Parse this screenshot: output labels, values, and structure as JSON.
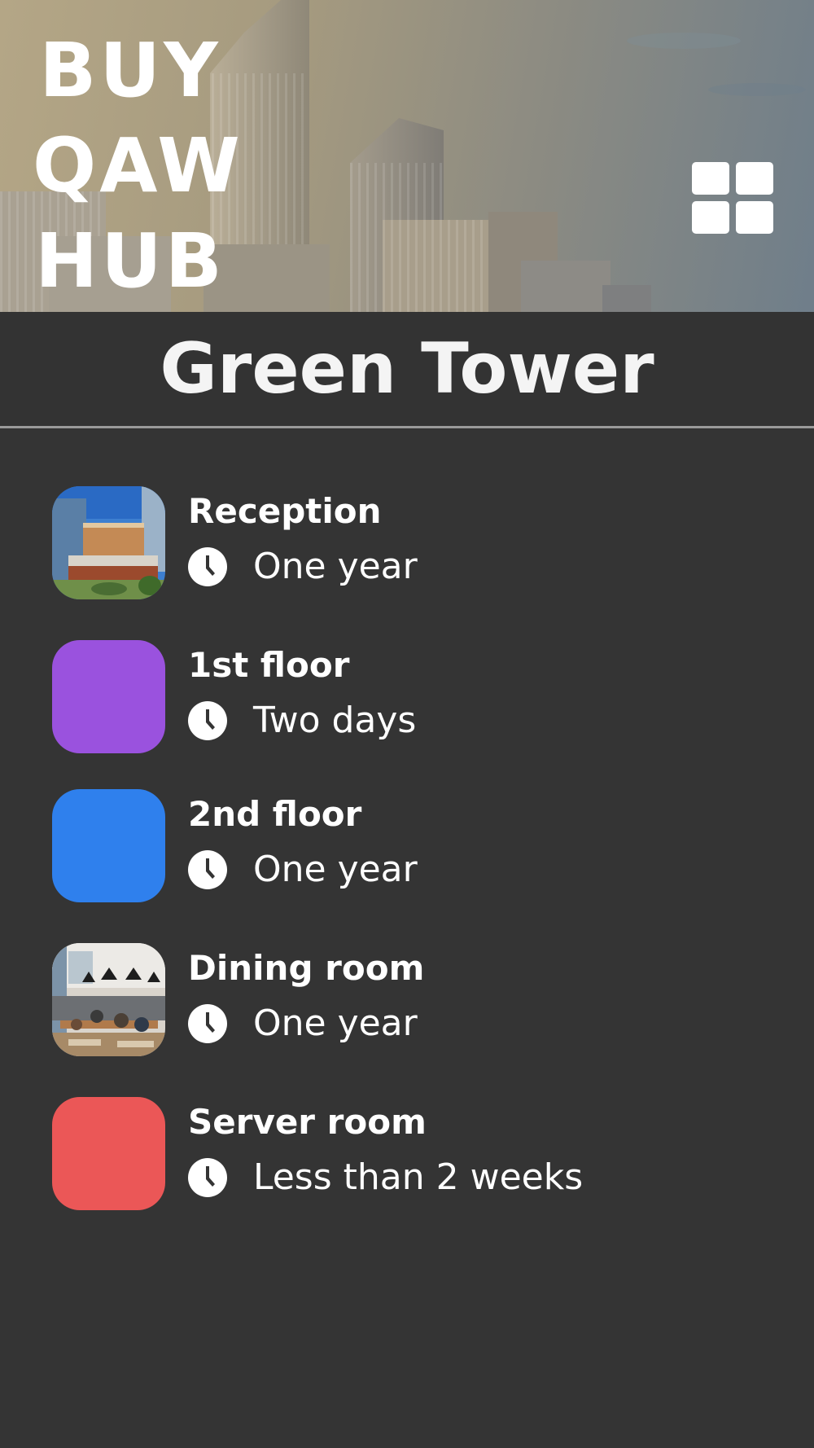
{
  "header": {
    "logo_lines": [
      "BUY",
      "QAW",
      "HUB"
    ],
    "menu_icon": "grid-icon"
  },
  "page_title": "Green Tower",
  "rooms": [
    {
      "name": "Reception",
      "duration": "One year",
      "thumb": "photo-building",
      "icon": "clock-icon"
    },
    {
      "name": "1st floor",
      "duration": "Two days",
      "thumb": "color",
      "color": "#9a52de",
      "icon": "clock-icon"
    },
    {
      "name": "2nd floor",
      "duration": "One year",
      "thumb": "color",
      "color": "#2f80ed",
      "icon": "clock-icon"
    },
    {
      "name": "Dining room",
      "duration": "One year",
      "thumb": "photo-dining",
      "icon": "clock-icon"
    },
    {
      "name": "Server room",
      "duration": "Less than 2 weeks",
      "thumb": "color",
      "color": "#eb5757",
      "icon": "clock-icon"
    }
  ],
  "colors": {
    "background": "#343434",
    "text": "#ffffff",
    "divider": "#9a9a9a"
  }
}
